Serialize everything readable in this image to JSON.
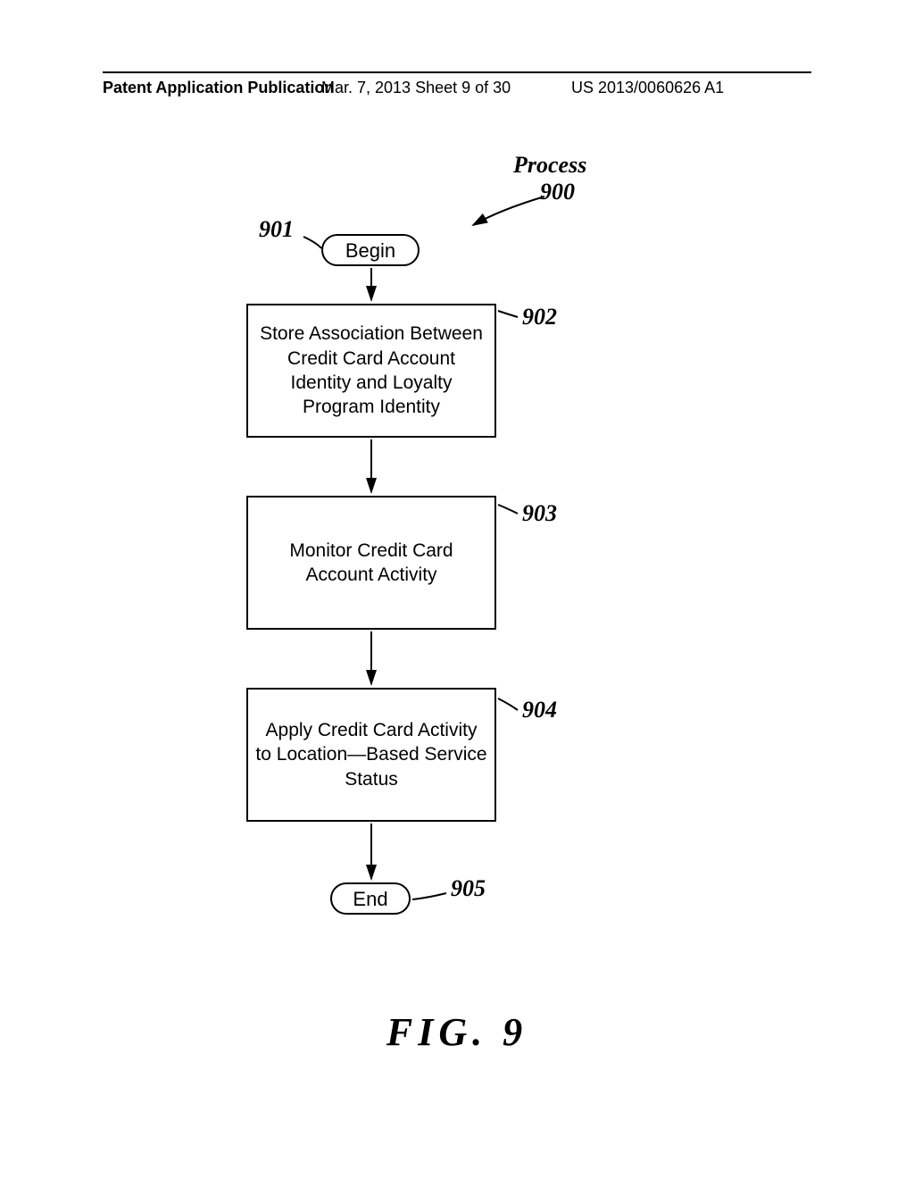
{
  "header": {
    "left": "Patent Application Publication",
    "center": "Mar. 7, 2013  Sheet 9 of 30",
    "right": "US 2013/0060626 A1"
  },
  "process": {
    "label": "Process",
    "number": "900"
  },
  "refs": {
    "r901": "901",
    "r902": "902",
    "r903": "903",
    "r904": "904",
    "r905": "905"
  },
  "nodes": {
    "begin": "Begin",
    "end": "End",
    "b902": "Store Association Between Credit Card Account Identity and Loyalty Program Identity",
    "b903": "Monitor Credit Card Account Activity",
    "b904": "Apply Credit Card Activity to Location—Based Service Status"
  },
  "figure": "FIG.  9"
}
